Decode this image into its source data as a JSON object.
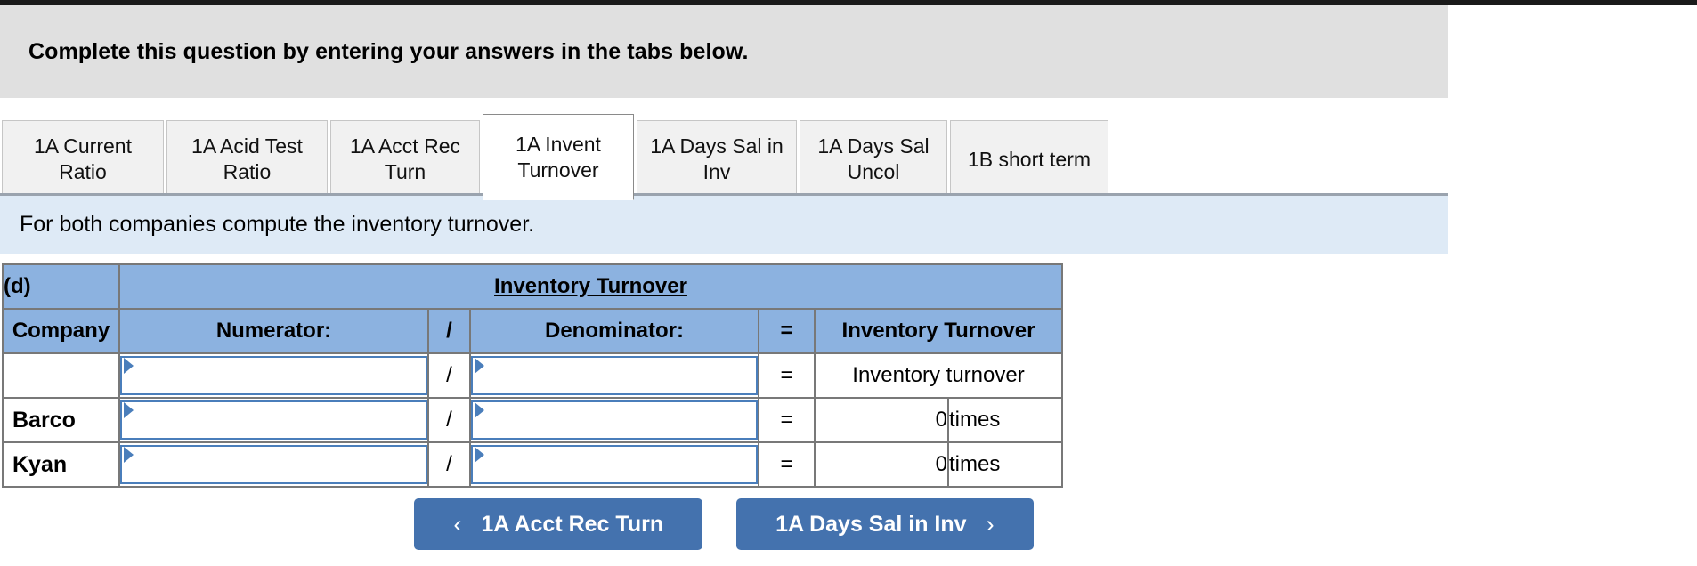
{
  "banner": {
    "text": "Complete this question by entering your answers in the tabs below."
  },
  "tabs": [
    {
      "label": "1A Current Ratio",
      "active": false
    },
    {
      "label": "1A Acid Test Ratio",
      "active": false
    },
    {
      "label": "1A Acct Rec Turn",
      "active": false
    },
    {
      "label": "1A Invent Turnover",
      "active": true
    },
    {
      "label": "1A Days Sal in Inv",
      "active": false
    },
    {
      "label": "1A Days Sal Uncol",
      "active": false
    },
    {
      "label": "1B short term",
      "active": false
    }
  ],
  "prompt": {
    "text": "For both companies compute the inventory turnover."
  },
  "worksheet": {
    "part_label": "(d)",
    "title": "Inventory Turnover",
    "columns": {
      "company": "Company",
      "numerator": "Numerator:",
      "slash": "/",
      "denominator": "Denominator:",
      "equals": "=",
      "result": "Inventory Turnover"
    },
    "rows": [
      {
        "company": "",
        "numerator_value": "",
        "numerator_placeholder": "",
        "slash": "/",
        "denominator_value": "",
        "denominator_placeholder": "",
        "equals": "=",
        "result": "Inventory turnover",
        "unit": "",
        "result_spans": true
      },
      {
        "company": "Barco",
        "numerator_value": "",
        "numerator_placeholder": "",
        "slash": "/",
        "denominator_value": "",
        "denominator_placeholder": "",
        "equals": "=",
        "result": "0",
        "unit": "times",
        "result_spans": false
      },
      {
        "company": "Kyan",
        "numerator_value": "",
        "numerator_placeholder": "",
        "slash": "/",
        "denominator_value": "",
        "denominator_placeholder": "",
        "equals": "=",
        "result": "0",
        "unit": "times",
        "result_spans": false
      }
    ]
  },
  "nav": {
    "prev_label": "1A Acct Rec Turn",
    "prev_chevron": "‹",
    "next_label": "1A Days Sal in Inv",
    "next_chevron": "›"
  },
  "colors": {
    "header_fill": "#8cb2e0",
    "banner_fill": "#e0e0e0",
    "prompt_fill": "#deeaf6",
    "button_fill": "#4472ae",
    "input_border": "#4a7ebb"
  }
}
